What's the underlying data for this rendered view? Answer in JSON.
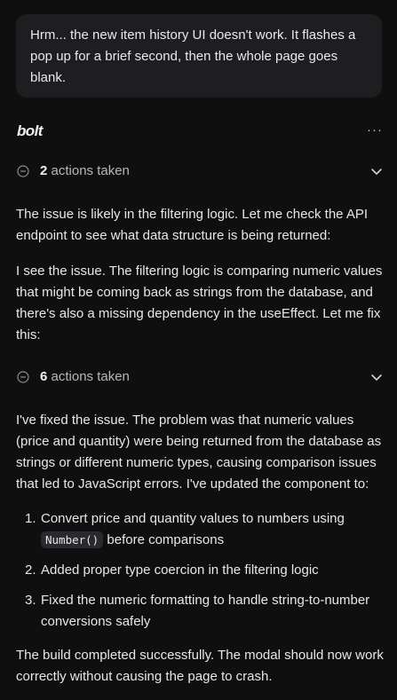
{
  "user_message": {
    "text": "Hrm... the new item history UI doesn't work. It flashes a pop up for a brief second, then the whole page goes blank."
  },
  "assistant": {
    "logo_text": "bolt",
    "more_label": "···",
    "actions_group_1": {
      "count": "2",
      "label": " actions taken",
      "status_icon": "circle-minus-icon",
      "toggle_icon": "chevron-down-icon"
    },
    "para_1": "The issue is likely in the filtering logic. Let me check the API endpoint to see what data structure is being returned:",
    "para_2": "I see the issue. The filtering logic is comparing numeric values that might be coming back as strings from the database, and there's also a missing dependency in the useEffect. Let me fix this:",
    "actions_group_2": {
      "count": "6",
      "label": " actions taken",
      "status_icon": "circle-minus-icon",
      "toggle_icon": "chevron-down-icon"
    },
    "para_3": "I've fixed the issue. The problem was that numeric values (price and quantity) were being returned from the database as strings or different numeric types, causing comparison issues that led to JavaScript errors. I've updated the component to:",
    "list": [
      {
        "number": "1.",
        "before": "Convert price and quantity values to numbers using ",
        "code": "Number()",
        "after": " before comparisons"
      },
      {
        "number": "2.",
        "text": "Added proper type coercion in the filtering logic"
      },
      {
        "number": "3.",
        "text": "Fixed the numeric formatting to handle string-to-number conversions safely"
      }
    ],
    "para_4": "The build completed successfully. The modal should now work correctly without causing the page to crash."
  },
  "colors": {
    "background": "#0f0f10",
    "bubble": "#1e1e21",
    "text": "#e7e7e9",
    "muted": "#b7b7bc",
    "code_bg": "#2a2a2e"
  }
}
